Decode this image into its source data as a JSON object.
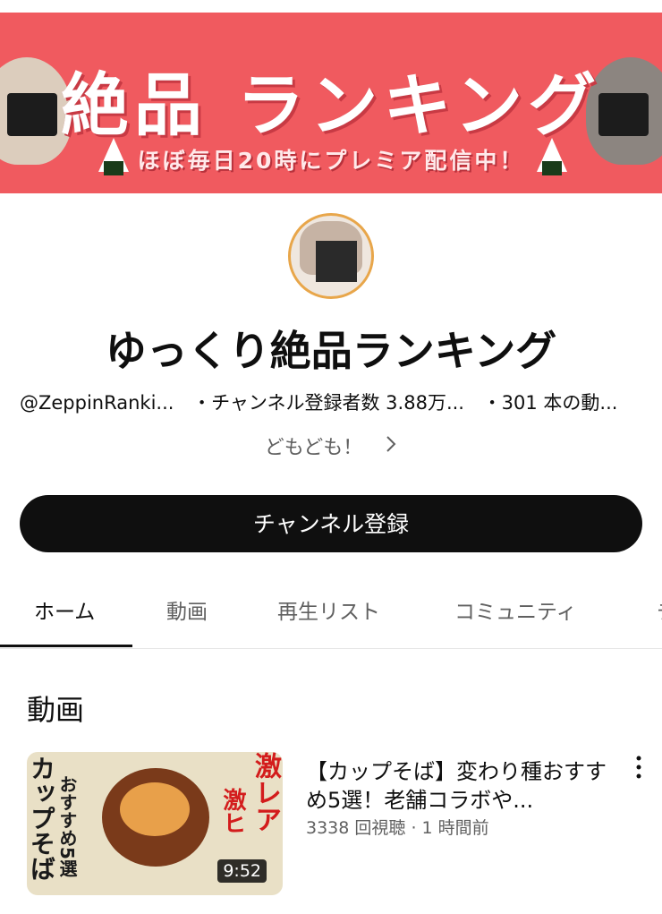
{
  "banner": {
    "title": "絶品 ランキング",
    "subtitle": "ほぼ毎日20時にプレミア配信中！"
  },
  "channel": {
    "name": "ゆっくり絶品ランキング",
    "handle": "@ZeppinRanki...",
    "subscribers": "・チャンネル登録者数 3.88万...",
    "videos": "・301 本の動...",
    "description": "どもども！",
    "subscribe_label": "チャンネル登録"
  },
  "tabs": [
    {
      "label": "ホーム"
    },
    {
      "label": "動画"
    },
    {
      "label": "再生リスト"
    },
    {
      "label": "コミュニティ"
    },
    {
      "label": "チ"
    }
  ],
  "section": {
    "title": "動画"
  },
  "video": {
    "title": "【カップそば】変わり種おすすめ5選！老舗コラボや...",
    "views": "3338 回視聴",
    "age": "· 1 時間前",
    "duration": "9:52",
    "thumb_text_1": "カップそば",
    "thumb_text_2": "おすすめ5選",
    "thumb_text_3": "激レア",
    "thumb_text_4": "激ヒ"
  },
  "colors": {
    "banner": "#f05a5f",
    "subscribe_bg": "#0f0f0f",
    "avatar_ring": "#e8a64a"
  },
  "icons": {
    "description_chevron": "chevron-right-icon",
    "more": "more-vert-icon"
  }
}
